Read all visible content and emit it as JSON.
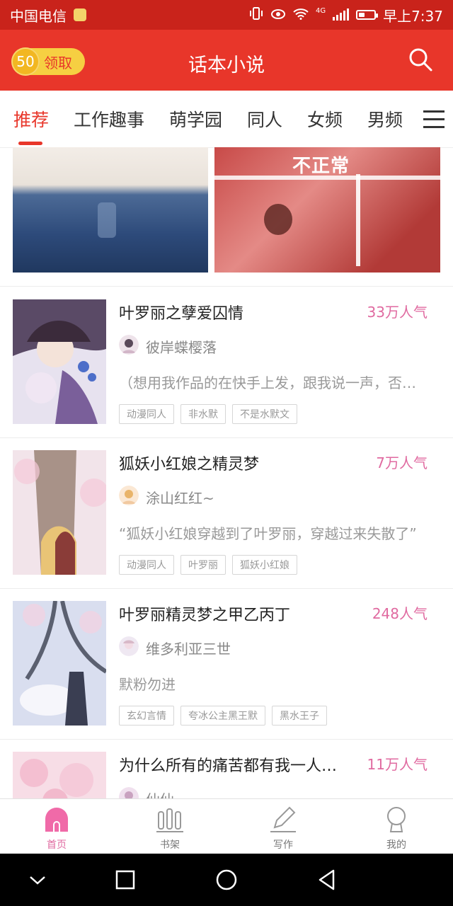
{
  "status_bar": {
    "carrier": "中国电信",
    "network": "4G",
    "time": "早上7:37"
  },
  "header": {
    "coin_count": "50",
    "claim_label": "领取",
    "title": "话本小说"
  },
  "tabs": [
    {
      "label": "推荐",
      "active": true
    },
    {
      "label": "工作趣事"
    },
    {
      "label": "萌学园"
    },
    {
      "label": "同人"
    },
    {
      "label": "女频"
    },
    {
      "label": "男频"
    }
  ],
  "banner": {
    "text": "不正常"
  },
  "books": [
    {
      "title": "叶罗丽之孽爱囚情",
      "popularity": "33万人气",
      "author": "彼岸蝶樱落",
      "description": "（想用我作品的在快手上发，跟我说一声，否…",
      "tags": [
        "动漫同人",
        "非水默",
        "不是水默文"
      ]
    },
    {
      "title": "狐妖小红娘之精灵梦",
      "popularity": "7万人气",
      "author": "涂山红红~",
      "description": "“狐妖小红娘穿越到了叶罗丽，穿越过来失散了”",
      "tags": [
        "动漫同人",
        "叶罗丽",
        "狐妖小红娘"
      ]
    },
    {
      "title": "叶罗丽精灵梦之甲乙丙丁",
      "popularity": "248人气",
      "author": "维多利亚三世",
      "description": "默粉勿进",
      "tags": [
        "玄幻言情",
        "夸冰公主黑王默",
        "黑水王子"
      ]
    },
    {
      "title": "为什么所有的痛苦都有我一人…",
      "popularity": "11万人气",
      "author": "仙仙",
      "description": "",
      "tags": []
    }
  ],
  "bottom_nav": [
    {
      "label": "首页",
      "icon": "home-icon",
      "active": true
    },
    {
      "label": "书架",
      "icon": "bookshelf-icon"
    },
    {
      "label": "写作",
      "icon": "pen-icon"
    },
    {
      "label": "我的",
      "icon": "profile-icon"
    }
  ],
  "colors": {
    "accent": "#e8362a",
    "popularity": "#e06aa0",
    "coin": "#f6cf42"
  }
}
